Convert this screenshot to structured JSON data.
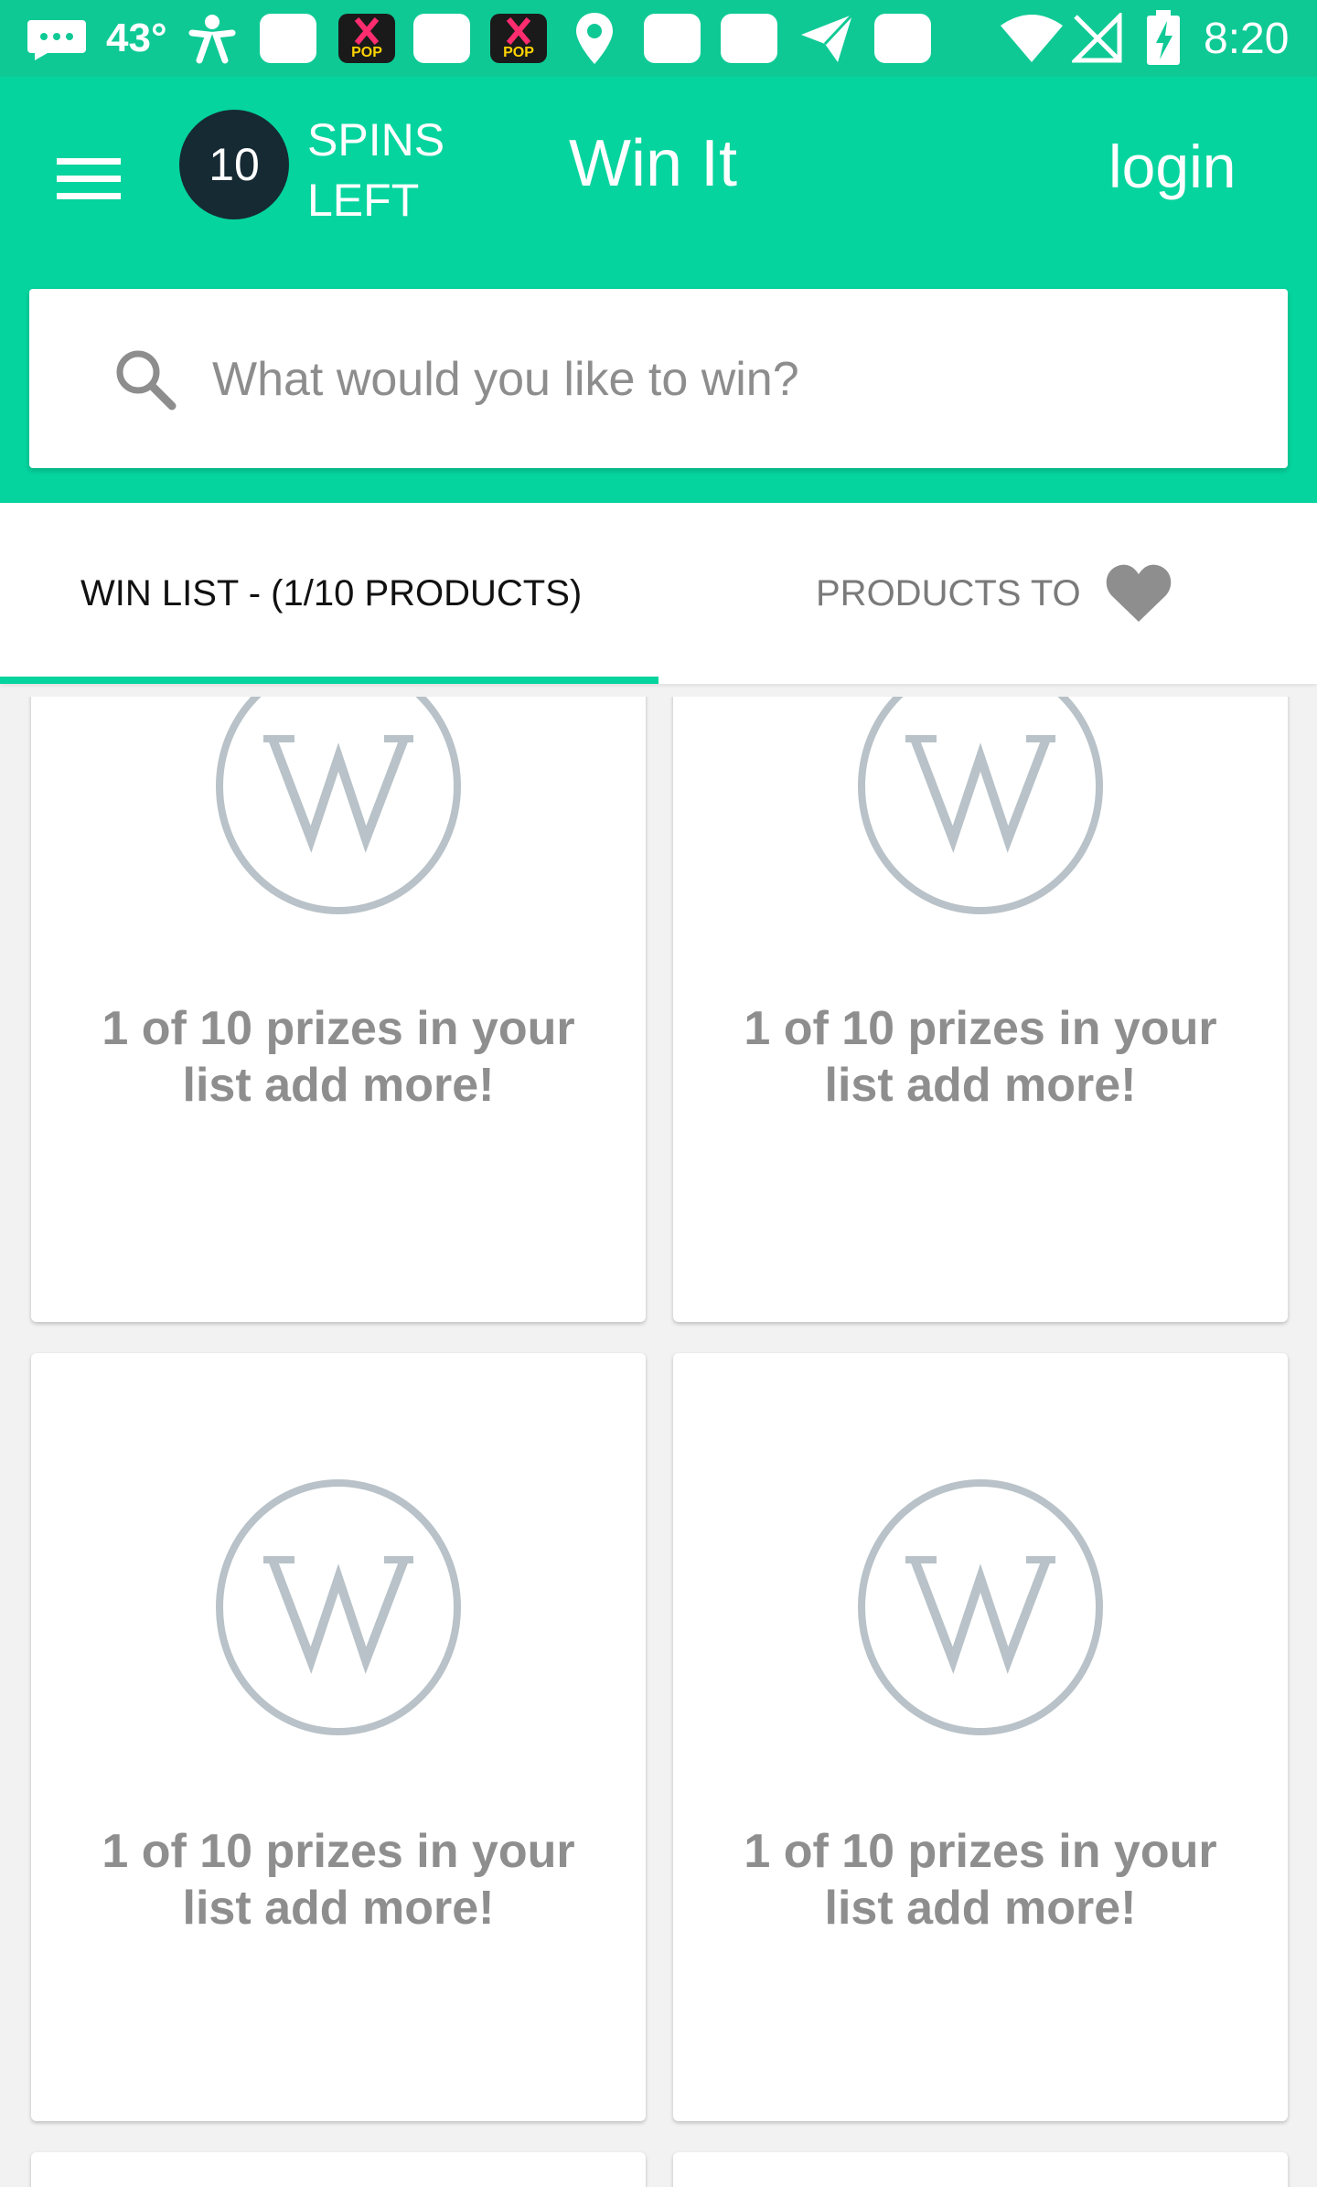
{
  "status_bar": {
    "temperature": "43°",
    "time": "8:20",
    "icons": [
      "messages-icon",
      "weather-icon",
      "app-figure-icon",
      "square-notification-icon",
      "kpop-app-icon",
      "square-notification-icon",
      "kpop-app-icon",
      "location-pin-icon",
      "square-notification-icon",
      "square-notification-icon",
      "send-icon",
      "square-notification-icon",
      "wifi-icon",
      "signal-icon",
      "battery-charging-icon"
    ]
  },
  "header": {
    "spins_count": "10",
    "spins_label_line1": "SPINS",
    "spins_label_line2": "LEFT",
    "title": "Win It",
    "login_label": "login"
  },
  "search": {
    "placeholder": "What would you like to win?",
    "value": ""
  },
  "tabs": [
    {
      "label": "WIN LIST - (1/10 PRODUCTS)",
      "selected": true
    },
    {
      "label": "PRODUCTS TO",
      "selected": false,
      "icon": "heart-icon"
    }
  ],
  "cards": [
    {
      "text": "1 of 10 prizes in your list add more!",
      "logo": "w-logo-icon"
    },
    {
      "text": "1 of 10 prizes in your list add more!",
      "logo": "w-logo-icon"
    },
    {
      "text": "1 of 10 prizes in your list add more!",
      "logo": "w-logo-icon"
    },
    {
      "text": "1 of 10 prizes in your list add more!",
      "logo": "w-logo-icon"
    }
  ],
  "colors": {
    "accent": "#05d49e",
    "status_bar": "#0fc995",
    "badge": "#162a33",
    "placeholder_logo": "#b8c2c8",
    "card_text": "#8e8e8e"
  }
}
